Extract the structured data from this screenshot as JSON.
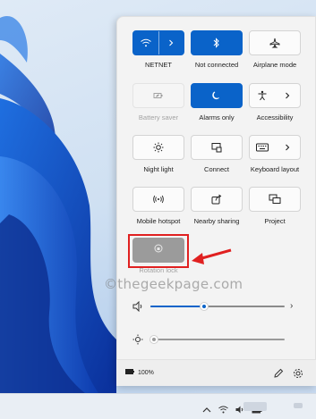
{
  "quick_settings": {
    "tiles": [
      {
        "id": "wifi",
        "label": "NETNET",
        "state": "on",
        "icon": "wifi-icon",
        "has_chevron": true
      },
      {
        "id": "bluetooth",
        "label": "Not connected",
        "state": "on",
        "icon": "bluetooth-icon",
        "has_chevron": false
      },
      {
        "id": "airplane",
        "label": "Airplane mode",
        "state": "off",
        "icon": "airplane-icon",
        "has_chevron": false
      },
      {
        "id": "battery-saver",
        "label": "Battery saver",
        "state": "disabled",
        "icon": "battery-leaf-icon",
        "has_chevron": false
      },
      {
        "id": "focus",
        "label": "Alarms only",
        "state": "on",
        "icon": "moon-icon",
        "has_chevron": false
      },
      {
        "id": "accessibility",
        "label": "Accessibility",
        "state": "off",
        "icon": "accessibility-icon",
        "has_chevron": true
      },
      {
        "id": "night-light",
        "label": "Night light",
        "state": "off",
        "icon": "sun-icon",
        "has_chevron": false
      },
      {
        "id": "connect",
        "label": "Connect",
        "state": "off",
        "icon": "cast-icon",
        "has_chevron": false
      },
      {
        "id": "keyboard",
        "label": "Keyboard layout",
        "state": "off",
        "icon": "keyboard-icon",
        "has_chevron": true
      },
      {
        "id": "hotspot",
        "label": "Mobile hotspot",
        "state": "off",
        "icon": "hotspot-icon",
        "has_chevron": false
      },
      {
        "id": "nearby",
        "label": "Nearby sharing",
        "state": "off",
        "icon": "share-icon",
        "has_chevron": false
      },
      {
        "id": "project",
        "label": "Project",
        "state": "off",
        "icon": "project-icon",
        "has_chevron": false
      }
    ],
    "rotation_lock": {
      "label": "Rotation lock",
      "state": "disabled",
      "icon": "rotation-lock-icon"
    },
    "volume": {
      "icon": "speaker-icon",
      "level": 0.4,
      "chevron": "›"
    },
    "brightness": {
      "icon": "brightness-icon",
      "level": 0.0
    },
    "battery": {
      "icon": "battery-icon",
      "text": "100%"
    },
    "footer_icons": [
      "pencil-icon",
      "gear-icon"
    ]
  },
  "watermark": "©thegeekpage.com",
  "colors": {
    "accent": "#0a63c9",
    "highlight": "#e02020",
    "panel": "#f3f3f3"
  }
}
